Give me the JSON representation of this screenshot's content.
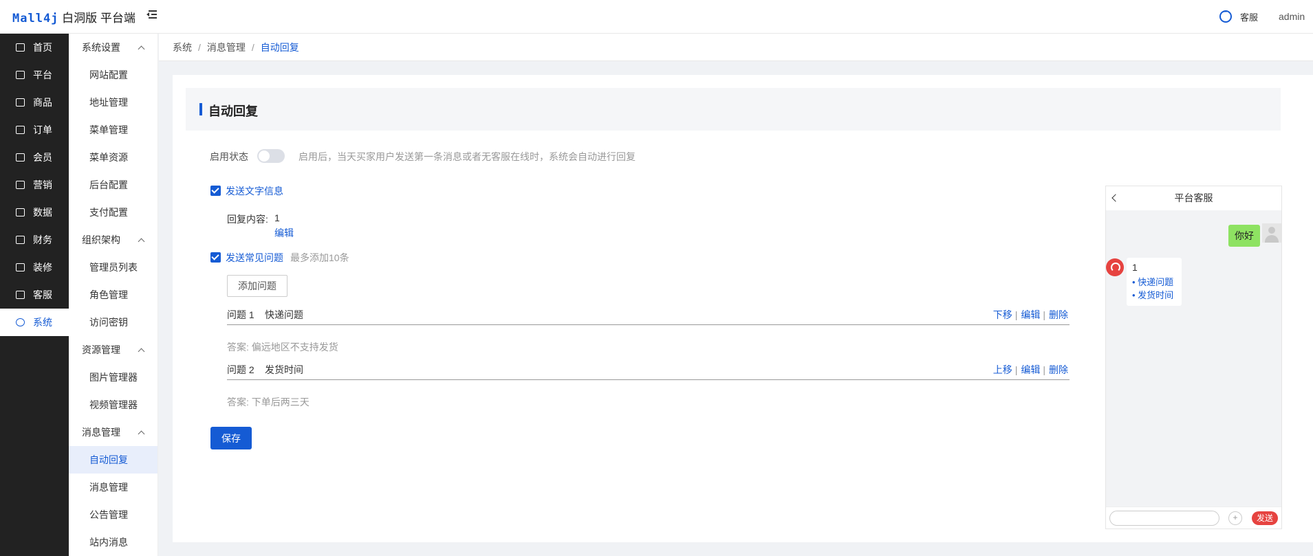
{
  "header": {
    "logo_brand": "Mall4j",
    "logo_suffix": "白洞版 平台端",
    "service_label": "客服",
    "user": "admin"
  },
  "nav1": [
    {
      "label": "首页",
      "icon": "dashboard-icon"
    },
    {
      "label": "平台",
      "icon": "monitor-icon"
    },
    {
      "label": "商品",
      "icon": "product-icon"
    },
    {
      "label": "订单",
      "icon": "order-icon"
    },
    {
      "label": "会员",
      "icon": "member-icon"
    },
    {
      "label": "营销",
      "icon": "gift-icon"
    },
    {
      "label": "数据",
      "icon": "chart-icon"
    },
    {
      "label": "财务",
      "icon": "finance-icon"
    },
    {
      "label": "装修",
      "icon": "decorate-icon"
    },
    {
      "label": "客服",
      "icon": "chat-icon"
    },
    {
      "label": "系统",
      "icon": "settings-icon"
    }
  ],
  "nav2": {
    "groups": [
      {
        "title": "系统设置",
        "items": [
          "网站配置",
          "地址管理",
          "菜单管理",
          "菜单资源",
          "后台配置",
          "支付配置"
        ]
      },
      {
        "title": "组织架构",
        "items": [
          "管理员列表",
          "角色管理",
          "访问密钥"
        ]
      },
      {
        "title": "资源管理",
        "items": [
          "图片管理器",
          "视频管理器"
        ]
      },
      {
        "title": "消息管理",
        "items": [
          "自动回复",
          "消息管理",
          "公告管理",
          "站内消息"
        ]
      }
    ]
  },
  "breadcrumb": [
    "系统",
    "消息管理",
    "自动回复"
  ],
  "page": {
    "title": "自动回复",
    "status_label": "启用状态",
    "status_enabled": false,
    "status_hint": "启用后，当天买家用户发送第一条消息或者无客服在线时，系统会自动进行回复",
    "send_text_label": "发送文字信息",
    "reply_content_label": "回复内容:",
    "reply_content_value": "1",
    "edit_link": "编辑",
    "send_faq_label": "发送常见问题",
    "faq_hint": "最多添加10条",
    "add_question": "添加问题",
    "questions": [
      {
        "no": "问题 1",
        "title": "快递问题",
        "move": "下移",
        "edit": "编辑",
        "delete": "删除",
        "answer": "答案: 偏远地区不支持发货"
      },
      {
        "no": "问题 2",
        "title": "发货时间",
        "move": "上移",
        "edit": "编辑",
        "delete": "删除",
        "answer": "答案: 下单后两三天"
      }
    ],
    "save": "保存"
  },
  "preview": {
    "title": "平台客服",
    "user_msg": "你好",
    "reply": "1",
    "links": [
      "• 快递问题",
      "• 发货时间"
    ],
    "plus": "+",
    "send": "发送"
  },
  "colors": {
    "primary": "#155bd4",
    "sidebar_bg": "#222222",
    "send_red": "#e64340",
    "bubble_green": "#8ee262"
  }
}
